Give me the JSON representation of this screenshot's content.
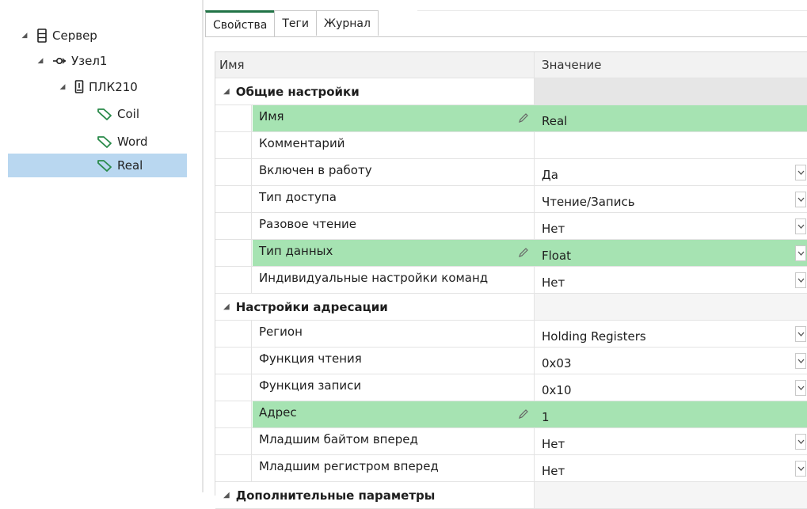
{
  "tree": {
    "server": "Сервер",
    "node": "Узел1",
    "device": "ПЛК210",
    "tags": [
      "Coil",
      "Word",
      "Real"
    ],
    "selected": "Real"
  },
  "tabs": [
    "Свойства",
    "Теги",
    "Журнал"
  ],
  "active_tab": "Свойства",
  "grid": {
    "col_name": "Имя",
    "col_value": "Значение",
    "section1": {
      "title": "Общие настройки",
      "rows": [
        {
          "name": "Имя",
          "value": "Real",
          "highlight": true,
          "editable": true
        },
        {
          "name": "Комментарий",
          "value": ""
        },
        {
          "name": "Включен в работу",
          "value": "Да",
          "dropdown": true
        },
        {
          "name": "Тип доступа",
          "value": "Чтение/Запись",
          "dropdown": true
        },
        {
          "name": "Разовое чтение",
          "value": "Нет",
          "dropdown": true
        },
        {
          "name": "Тип данных",
          "value": "Float",
          "dropdown": true,
          "highlight": true,
          "editable": true
        },
        {
          "name": "Индивидуальные настройки команд",
          "value": "Нет",
          "dropdown": true
        }
      ]
    },
    "section2": {
      "title": "Настройки адресации",
      "rows": [
        {
          "name": "Регион",
          "value": "Holding Registers",
          "dropdown": true
        },
        {
          "name": "Функция чтения",
          "value": "0x03",
          "dropdown": true
        },
        {
          "name": "Функция записи",
          "value": "0x10",
          "dropdown": true
        },
        {
          "name": "Адрес",
          "value": "1",
          "highlight": true,
          "editable": true
        },
        {
          "name": "Младшим байтом вперед",
          "value": "Нет",
          "dropdown": true
        },
        {
          "name": "Младшим регистром вперед",
          "value": "Нет",
          "dropdown": true
        }
      ]
    },
    "section3": {
      "title": "Дополнительные параметры"
    }
  },
  "colors": {
    "highlight": "#a6e3b2",
    "selection": "#b9d7f0",
    "tag_icon": "#2a8a4a",
    "active_tab_accent": "#217346"
  },
  "icons": {
    "server": "server-icon",
    "node": "node-link-icon",
    "device": "plc-device-icon",
    "tag": "tag-icon",
    "edit": "pencil-icon",
    "dropdown": "chevron-down-icon"
  }
}
